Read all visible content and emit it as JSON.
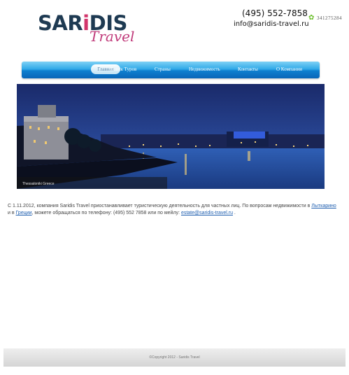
{
  "logo": {
    "main_prefix": "SAR",
    "main_accent": "i",
    "main_suffix": "DIS",
    "sub": "Travel"
  },
  "contacts": {
    "phone": "(495) 552-7858",
    "email": "info@saridis-travel.ru"
  },
  "counter": {
    "icon": "flower-icon",
    "value": "341275284"
  },
  "nav": {
    "items": [
      {
        "label": "Главная",
        "active": true
      },
      {
        "label": "Поиск Туров"
      },
      {
        "label": "Страны"
      },
      {
        "label": "Недвижимость"
      },
      {
        "label": "Контакты"
      },
      {
        "label": "О Компании"
      }
    ]
  },
  "hero": {
    "caption": "Thessaloniki Greece"
  },
  "content": {
    "text1": "С 1.11.2012, компания Saridis Travel приостанавливает туристическую деятельность для частных лиц. По вопросам недвижимости в ",
    "link1": "Лыткарино",
    "text2": " и в ",
    "link2": "Греции",
    "text3": ", можете обращаться по телефону: (495) 552 7858 или по мейлу: ",
    "link3": "estate@saridis-travel.ru",
    "text4": " ."
  },
  "footer": {
    "text": "©Copyright  2012 - Saridis Travel"
  },
  "colors": {
    "brand_dark": "#1e3a52",
    "brand_accent": "#d2356b",
    "nav_blue": "#1a8ad8",
    "link": "#1f5fb0"
  }
}
